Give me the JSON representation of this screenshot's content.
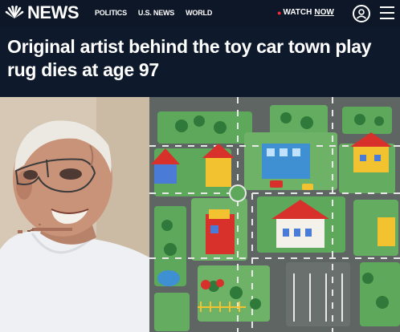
{
  "header": {
    "brand": "NEWS",
    "nav_links": [
      "POLITICS",
      "U.S. NEWS",
      "WORLD"
    ],
    "watch_label": "WATCH",
    "watch_now": "NOW"
  },
  "article": {
    "headline": "Original artist behind the toy car town play rug dies at age 97"
  },
  "colors": {
    "nav_bg": "#0d1727",
    "live_accent": "#ff2a3a"
  }
}
